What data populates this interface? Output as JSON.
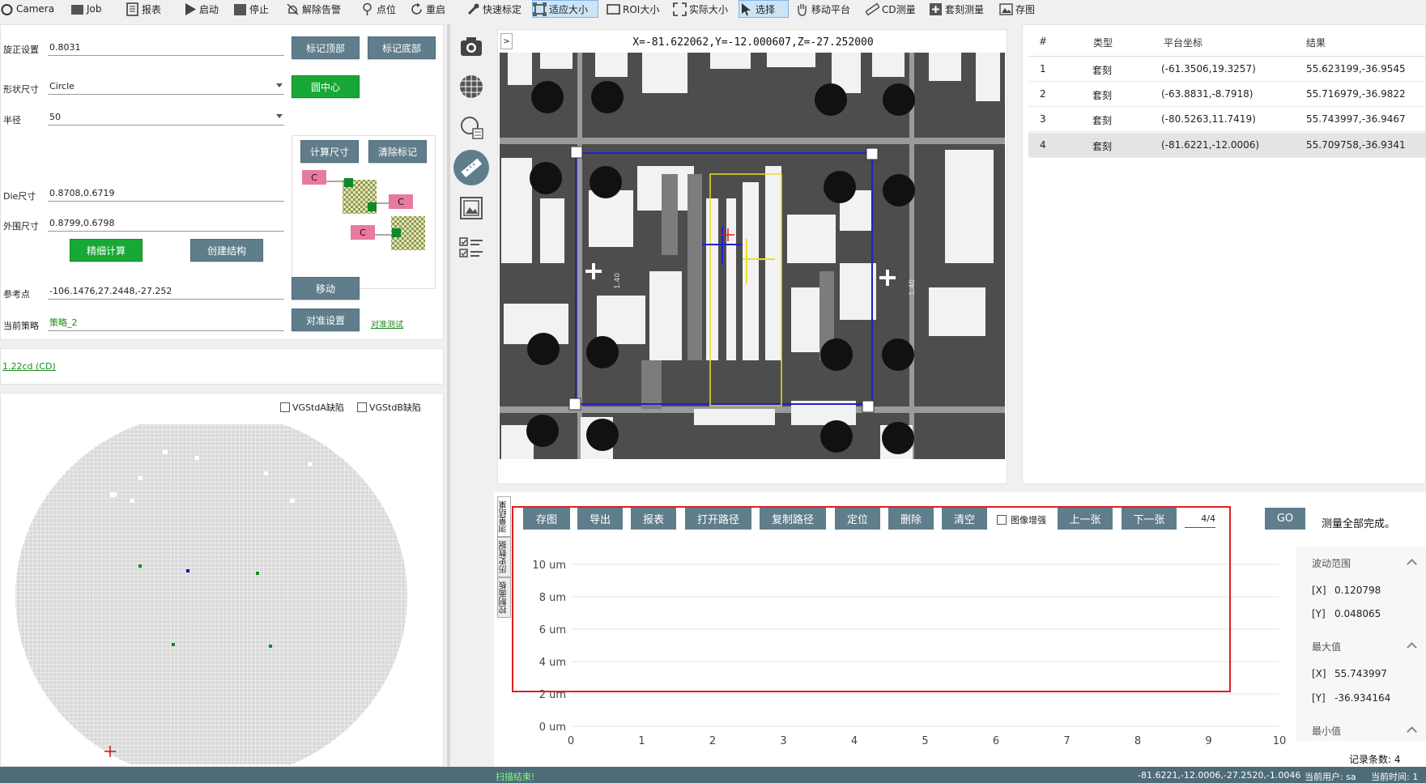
{
  "toolbar": {
    "items": [
      {
        "label": "Camera",
        "icon": "camera-icon"
      },
      {
        "label": "Job",
        "icon": "folder-icon"
      },
      {
        "label": "报表",
        "icon": "report-icon"
      },
      {
        "label": "启动",
        "icon": "play-icon"
      },
      {
        "label": "停止",
        "icon": "stop-icon"
      },
      {
        "label": "解除告警",
        "icon": "bell-off-icon"
      },
      {
        "label": "点位",
        "icon": "pin-icon"
      },
      {
        "label": "重启",
        "icon": "restart-icon"
      },
      {
        "label": "快速标定",
        "icon": "wrench-icon"
      },
      {
        "label": "适应大小",
        "icon": "fit-icon",
        "active": true
      },
      {
        "label": "ROI大小",
        "icon": "roi-icon"
      },
      {
        "label": "实际大小",
        "icon": "expand-icon"
      },
      {
        "label": "选择",
        "icon": "cursor-icon",
        "active": true
      },
      {
        "label": "移动平台",
        "icon": "hand-icon"
      },
      {
        "label": "CD测量",
        "icon": "ruler-icon"
      },
      {
        "label": "套刻测量",
        "icon": "plus-box-icon"
      },
      {
        "label": "存图",
        "icon": "image-icon"
      }
    ]
  },
  "settings": {
    "rotation_label": "旋正设置",
    "rotation_value": "0.8031",
    "mark_top": "标记顶部",
    "mark_bottom": "标记底部",
    "shape_label": "形状尺寸",
    "shape_value": "Circle",
    "circle_center": "圆中心",
    "radius_label": "半径",
    "radius_value": "50",
    "calc_size": "计算尺寸",
    "clear_mark": "清除标记",
    "die_label": "Die尺寸",
    "die_value": "0.8708,0.6719",
    "outer_label": "外围尺寸",
    "outer_value": "0.8799,0.6798",
    "fine_calc": "精细计算",
    "create_struct": "创建结构",
    "ref_label": "参考点",
    "ref_value": "-106.1476,27.2448,-27.252",
    "move": "移动",
    "strategy_label": "当前策略",
    "strategy_value": "策略_2",
    "align_setting": "对准设置",
    "align_test": "对准测试",
    "die_marker": "C"
  },
  "recipe_link": "1.22cd (CD)",
  "wafer": {
    "check_a": "VGStdA缺陷",
    "check_b": "VGStdB缺陷"
  },
  "image_view": {
    "coords": "X=-81.622062,Y=-12.000607,Z=-27.252000",
    "expand_btn": ">",
    "mark_text": "1.40"
  },
  "results_table": {
    "headers": [
      "#",
      "类型",
      "平台坐标",
      "结果"
    ],
    "rows": [
      {
        "id": "1",
        "type": "套刻",
        "coord": "(-61.3506,19.3257)",
        "result": "55.623199,-36.9545"
      },
      {
        "id": "2",
        "type": "套刻",
        "coord": "(-63.8831,-8.7918)",
        "result": "55.716979,-36.9822"
      },
      {
        "id": "3",
        "type": "套刻",
        "coord": "(-80.5263,11.7419)",
        "result": "55.743997,-36.9467"
      },
      {
        "id": "4",
        "type": "套刻",
        "coord": "(-81.6221,-12.0006)",
        "result": "55.709758,-36.9341"
      }
    ]
  },
  "side_tabs": [
    "测量结果",
    "历史数据",
    "控制面板"
  ],
  "bottom_toolbar": {
    "buttons": [
      "存图",
      "导出",
      "报表",
      "打开路径",
      "复制路径",
      "定位",
      "删除",
      "清空"
    ],
    "enhance_label": "图像增强",
    "prev": "上一张",
    "next": "下一张",
    "page": "4/4",
    "go": "GO",
    "status": "测量全部完成。"
  },
  "chart_data": {
    "type": "line",
    "title": "",
    "xlabel": "",
    "ylabel": "",
    "xlim": [
      0,
      10
    ],
    "ylim": [
      0,
      10
    ],
    "x_ticks": [
      "0",
      "1",
      "2",
      "3",
      "4",
      "5",
      "6",
      "7",
      "8",
      "9",
      "10"
    ],
    "y_ticks": [
      "0 um",
      "2 um",
      "4 um",
      "6 um",
      "8 um",
      "10 um"
    ],
    "series": [],
    "grid": true
  },
  "stats": {
    "range_title": "波动范围",
    "range_x_label": "[X]",
    "range_x": "0.120798",
    "range_y_label": "[Y]",
    "range_y": "0.048065",
    "max_title": "最大值",
    "max_x_label": "[X]",
    "max_x": "55.743997",
    "max_y_label": "[Y]",
    "max_y": "-36.934164",
    "min_title": "最小值",
    "record_count": "记录条数: 4"
  },
  "statusbar": {
    "left": "扫描结束!",
    "coords": "-81.6221,-12.0006,-27.2520,-1.0046",
    "user": "当前用户: sa",
    "time": "当前时间: 1"
  },
  "colors": {
    "button": "#607d8b",
    "green_button": "#18a835",
    "highlight_red": "#e02020",
    "overlay_blue": "#2020d0",
    "overlay_yellow": "#e8e020"
  }
}
